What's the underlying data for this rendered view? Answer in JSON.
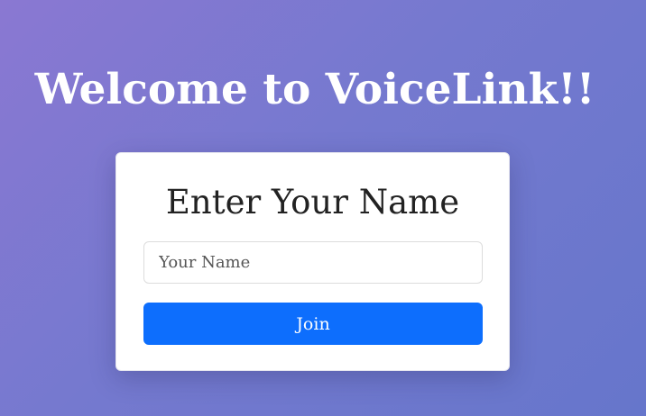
{
  "header": {
    "title": "Welcome to VoiceLink!!"
  },
  "form": {
    "title": "Enter Your Name",
    "name_placeholder": "Your Name",
    "name_value": "",
    "join_label": "Join"
  },
  "colors": {
    "background_start": "#8a78d2",
    "background_end": "#6676cb",
    "card_background": "#ffffff",
    "button_primary": "#0d6efd"
  }
}
